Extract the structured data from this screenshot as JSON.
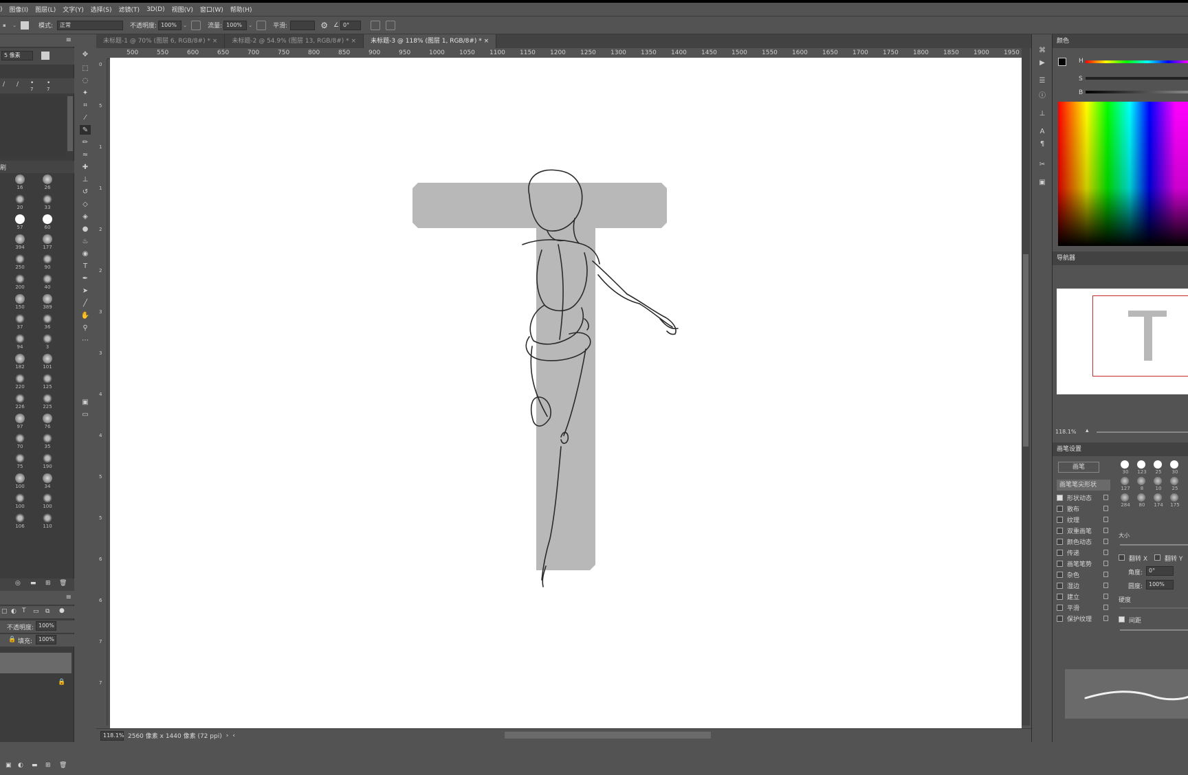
{
  "menu": [
    "图像(I)",
    "图层(L)",
    "文字(Y)",
    "选择(S)",
    "滤镜(T)",
    "3D(D)",
    "视图(V)",
    "窗口(W)",
    "帮助(H)"
  ],
  "options": {
    "mode_label": "模式:",
    "mode_value": "正常",
    "opacity_label": "不透明度:",
    "opacity_value": "100%",
    "flow_label": "流量:",
    "flow_value": "100%",
    "smooth_label": "平滑:",
    "angle_value": "0°"
  },
  "tabs": [
    {
      "label": "未标题-1 @ 70% (图层 6, RGB/8#) *"
    },
    {
      "label": "未标题-2 @ 54.9% (图层 13, RGB/8#) *"
    },
    {
      "label": "未标题-3 @ 118% (图层 1, RGB/8#) *"
    }
  ],
  "ruler_top": [
    "500",
    "550",
    "600",
    "650",
    "700",
    "750",
    "800",
    "850",
    "900",
    "950",
    "1000",
    "1050",
    "1100",
    "1150",
    "1200",
    "1250",
    "1300",
    "1350",
    "1400",
    "1450",
    "1500",
    "1550",
    "1600",
    "1650",
    "1700",
    "1750",
    "1800",
    "1850",
    "1900",
    "1950"
  ],
  "ruler_left": [
    "0",
    "5",
    "1",
    "1",
    "2",
    "2",
    "3",
    "3",
    "4",
    "4",
    "5",
    "5",
    "6",
    "6",
    "7",
    "7"
  ],
  "left_panel": {
    "brush_size": "5 像素",
    "section_label": "刷",
    "brush_numbers": [
      "16",
      "26",
      "20",
      "33",
      "57",
      "60",
      "394",
      "177",
      "250",
      "90",
      "200",
      "40",
      "150",
      "389",
      "37",
      "36",
      "94",
      "3",
      "182",
      "101",
      "220",
      "125",
      "226",
      "225",
      "97",
      "76",
      "70",
      "35",
      "75",
      "190",
      "100",
      "34",
      "100",
      "100",
      "106",
      "110"
    ],
    "small_nums": [
      "7",
      "7"
    ],
    "opacity_label": "不透明度:",
    "opacity_value": "100%",
    "fill_label": "填充:",
    "fill_value": "100%"
  },
  "status": {
    "zoom": "118.1%",
    "doc_info": "2560 像素 x 1440 像素 (72 ppi)"
  },
  "right_panel": {
    "color_tab": "颜色",
    "hsb": [
      "H",
      "S",
      "B"
    ],
    "navigator_tab": "导航器",
    "nav_zoom": "118.1%",
    "brush_settings_tab": "画笔设置",
    "brush_button": "画笔",
    "brush_tip_shape": "画笔笔尖形状",
    "brush_nums": [
      "30",
      "123",
      "25",
      "30",
      "127",
      "8",
      "10",
      "25",
      "284",
      "80",
      "174",
      "175"
    ],
    "options": [
      {
        "label": "形状动态",
        "checked": true
      },
      {
        "label": "散布",
        "checked": false
      },
      {
        "label": "纹理",
        "checked": false
      },
      {
        "label": "双重画笔",
        "checked": false
      },
      {
        "label": "颜色动态",
        "checked": false
      },
      {
        "label": "传递",
        "checked": false
      },
      {
        "label": "画笔笔势",
        "checked": false
      },
      {
        "label": "杂色",
        "checked": false
      },
      {
        "label": "湿边",
        "checked": false
      },
      {
        "label": "建立",
        "checked": false
      },
      {
        "label": "平滑",
        "checked": false
      },
      {
        "label": "保护纹理",
        "checked": false
      }
    ],
    "size_label": "大小",
    "flip_x": "翻转 X",
    "flip_y": "翻转 Y",
    "angle_label": "角度:",
    "angle_value": "0°",
    "roundness_label": "圆度:",
    "roundness_value": "100%",
    "hardness_label": "硬度",
    "spacing_label": "间距"
  }
}
